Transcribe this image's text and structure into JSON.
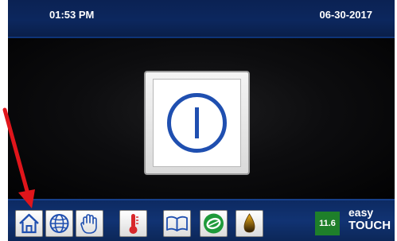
{
  "status_bar": {
    "time": "01:53 PM",
    "date": "06-30-2017"
  },
  "main": {
    "power_button_icon": "power-icon"
  },
  "nav_bar": {
    "buttons": [
      {
        "icon": "home-icon"
      },
      {
        "icon": "globe-icon"
      },
      {
        "icon": "hand-icon"
      },
      {
        "icon": "thermometer-icon"
      },
      {
        "icon": "book-icon"
      },
      {
        "icon": "eco-leaf-icon"
      },
      {
        "icon": "oil-drop-icon"
      }
    ],
    "pressure_value": "11.6",
    "logo": {
      "line1": "easy",
      "line2": "TOUCH"
    }
  },
  "annotation": {
    "arrow_color": "#e0151b",
    "points_to": "home-icon"
  },
  "colors": {
    "bar_blue": "#0c275e",
    "power_blue": "#1f4fb0",
    "pressure_green": "#1e7f2a"
  }
}
